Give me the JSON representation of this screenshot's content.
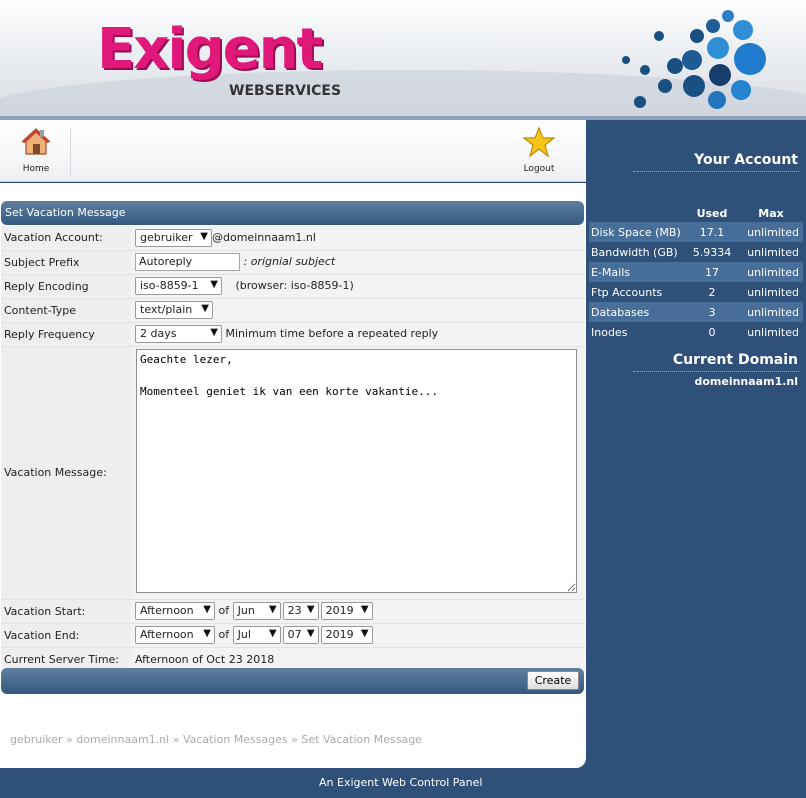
{
  "brand": {
    "name": "Exigent",
    "sub": "WEBSERVICES"
  },
  "nav": {
    "home": "Home",
    "logout": "Logout"
  },
  "form": {
    "title": "Set Vacation Message",
    "account_label": "Vacation Account:",
    "account_value": "gebruiker",
    "account_domain": "@domeinnaam1.nl",
    "subject_label": "Subject Prefix",
    "subject_value": "Autoreply",
    "subject_suffix": ": orignial subject",
    "encoding_label": "Reply Encoding",
    "encoding_value": "iso-8859-1",
    "encoding_note": "(browser: iso-8859-1)",
    "content_label": "Content-Type",
    "content_value": "text/plain",
    "freq_label": "Reply Frequency",
    "freq_value": "2 days",
    "freq_note": "Minimum time before a repeated reply",
    "message_label": "Vacation Message:",
    "message_value": "Geachte lezer,\n\nMomenteel geniet ik van een korte vakantie...",
    "start_label": "Vacation Start:",
    "start_time": "Afternoon",
    "start_of": "of",
    "start_month": "Jun",
    "start_day": "23",
    "start_year": "2019",
    "end_label": "Vacation End:",
    "end_time": "Afternoon",
    "end_of": "of",
    "end_month": "Jul",
    "end_day": "07",
    "end_year": "2019",
    "server_label": "Current Server Time:",
    "server_value": "Afternoon of Oct 23 2018",
    "create_label": "Create"
  },
  "breadcrumb": {
    "items": [
      "gebruiker",
      "domeinnaam1.nl",
      "Vacation Messages",
      "Set Vacation Message"
    ],
    "sep": "»"
  },
  "account": {
    "title": "Your Account",
    "col_used": "Used",
    "col_max": "Max",
    "rows": [
      {
        "label": "Disk Space (MB)",
        "used": "17.1",
        "max": "unlimited"
      },
      {
        "label": "Bandwidth (GB)",
        "used": "5.9334",
        "max": "unlimited"
      },
      {
        "label": "E-Mails",
        "used": "17",
        "max": "unlimited"
      },
      {
        "label": "Ftp Accounts",
        "used": "2",
        "max": "unlimited"
      },
      {
        "label": "Databases",
        "used": "3",
        "max": "unlimited"
      },
      {
        "label": "Inodes",
        "used": "0",
        "max": "unlimited"
      }
    ]
  },
  "domain": {
    "title": "Current Domain",
    "name": "domeinnaam1.nl"
  },
  "footer": {
    "text": "An Exigent Web Control Panel"
  }
}
